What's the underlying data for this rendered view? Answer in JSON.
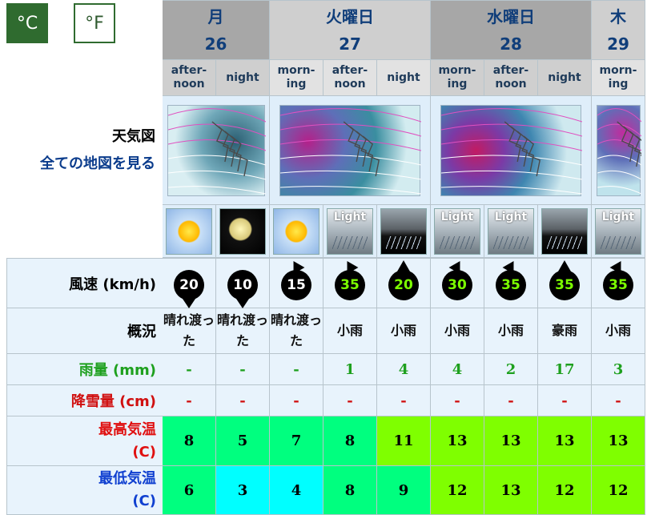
{
  "units": {
    "celsius": "°C",
    "fahrenheit": "°F"
  },
  "days": [
    {
      "name": "月",
      "date": "26"
    },
    {
      "name": "火曜日",
      "date": "27"
    },
    {
      "name": "水曜日",
      "date": "28"
    },
    {
      "name": "木",
      "date": "29"
    }
  ],
  "periods": [
    "after-\nnoon",
    "night",
    "morn-\ning",
    "after-\nnoon",
    "night",
    "morn-\ning",
    "after-\nnoon",
    "night",
    "morn-\ning"
  ],
  "map_section": {
    "title": "天気図",
    "link": "全ての地図を見る"
  },
  "weather_icons": [
    "sunny-icon",
    "clear-night-icon",
    "sunny-icon",
    "light-rain-icon",
    "night-rain-icon",
    "light-rain-icon",
    "light-rain-icon",
    "heavy-rain-night-icon",
    "light-rain-icon"
  ],
  "icon_text": {
    "light": "Light"
  },
  "rows": {
    "wind_label": "風速 (km/h)",
    "summary_label": "概況",
    "rain_label": "雨量 (mm)",
    "snow_label": "降雪量 (cm)",
    "tmax_label": "最高気温",
    "tmin_label": "最低気温",
    "temp_unit": "(C)"
  },
  "wind": [
    {
      "speed": "20",
      "dir": "down"
    },
    {
      "speed": "10",
      "dir": "down"
    },
    {
      "speed": "15",
      "dir": "up-left"
    },
    {
      "speed": "35",
      "dir": "up-left"
    },
    {
      "speed": "20",
      "dir": "up"
    },
    {
      "speed": "30",
      "dir": "up-right"
    },
    {
      "speed": "35",
      "dir": "up-right"
    },
    {
      "speed": "35",
      "dir": "up"
    },
    {
      "speed": "35",
      "dir": "up-right"
    }
  ],
  "summary": [
    "晴れ渡っ\nた",
    "晴れ渡っ\nた",
    "晴れ渡っ\nた",
    "小雨",
    "小雨",
    "小雨",
    "小雨",
    "豪雨",
    "小雨"
  ],
  "rain": [
    "-",
    "-",
    "-",
    "1",
    "4",
    "4",
    "2",
    "17",
    "3"
  ],
  "snow": [
    "-",
    "-",
    "-",
    "-",
    "-",
    "-",
    "-",
    "-",
    "-"
  ],
  "tmax": [
    "8",
    "5",
    "7",
    "8",
    "11",
    "13",
    "13",
    "13",
    "13"
  ],
  "tmin": [
    "6",
    "3",
    "4",
    "8",
    "9",
    "12",
    "13",
    "12",
    "12"
  ],
  "colors": {
    "tmax_bg": [
      "#00ff7f",
      "#00ff7f",
      "#00ff7f",
      "#00ff7f",
      "#7fff00",
      "#7fff00",
      "#7fff00",
      "#7fff00",
      "#7fff00"
    ],
    "tmin_bg": [
      "#00ff7f",
      "#00ffff",
      "#00ffff",
      "#00ff7f",
      "#00ff7f",
      "#7fff00",
      "#7fff00",
      "#7fff00",
      "#7fff00"
    ],
    "rain_label": "#1ea01e",
    "snow_label": "#d01010",
    "tmax_label": "#e01010",
    "tmin_label": "#1040d0"
  }
}
